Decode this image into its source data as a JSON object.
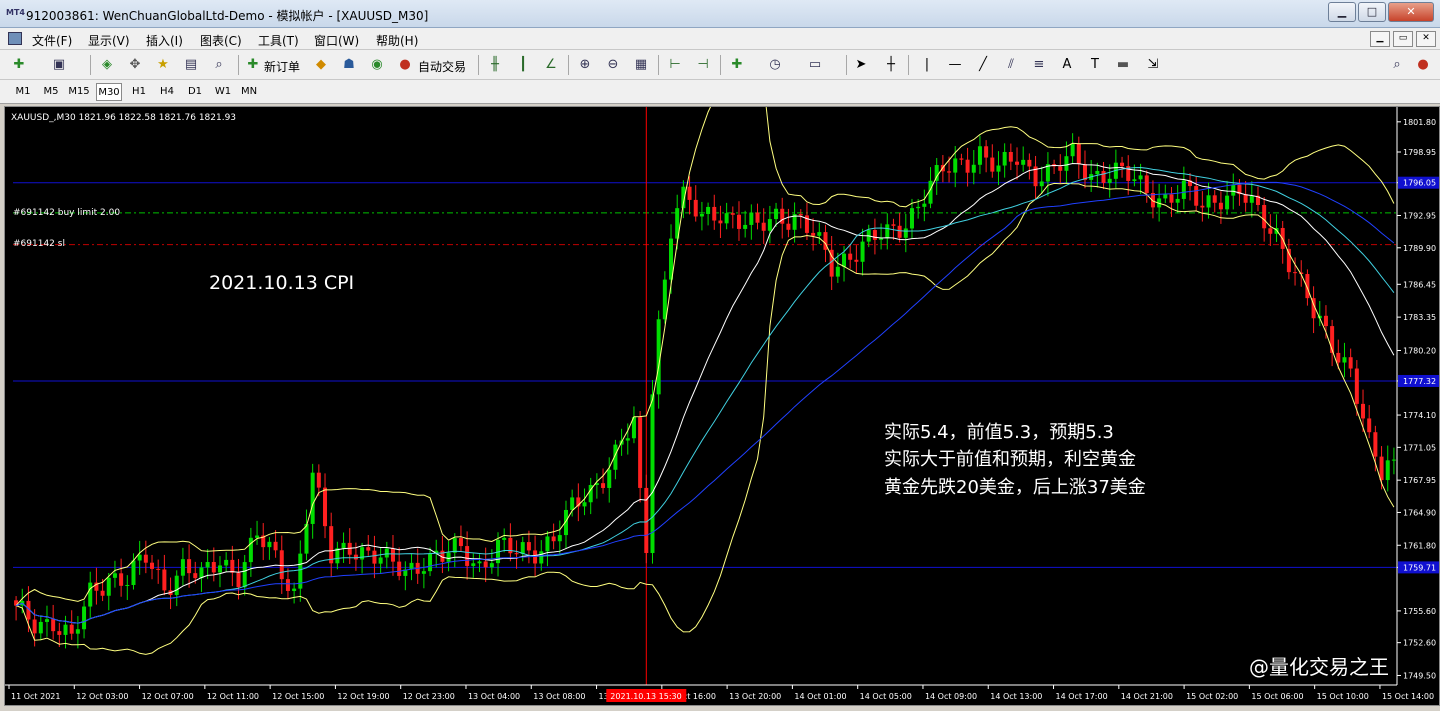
{
  "window": {
    "app_icon": "MT4",
    "title": "912003861: WenChuanGlobalLtd-Demo - 模拟帐户 - [XAUUSD_M30]",
    "minimize": "▁",
    "maximize": "□",
    "close": "✕"
  },
  "menu": {
    "items": [
      "文件(F)",
      "显示(V)",
      "插入(I)",
      "图表(C)",
      "工具(T)",
      "窗口(W)",
      "帮助(H)"
    ],
    "mdi_controls": [
      "▁",
      "▭",
      "✕"
    ]
  },
  "toolbar": {
    "new_order_label": "新订单",
    "auto_trading_label": "自动交易",
    "line_label": "|",
    "hline_label": "—",
    "text_label": "A",
    "textlabel_label": "T"
  },
  "timeframes": [
    "M1",
    "M5",
    "M15",
    "M30",
    "H1",
    "H4",
    "D1",
    "W1",
    "MN"
  ],
  "active_timeframe": "M30",
  "chart": {
    "header": "XAUUSD_,M30  1821.96 1822.58 1821.76 1821.93",
    "order_label_buy": "#691142 buy limit 2.00",
    "order_label_sl": "#691142 sl",
    "event_label": "2021.10.13  CPI",
    "annotation_lines": [
      "实际5.4，前值5.3，预期5.3",
      "实际大于前值和预期，利空黄金",
      "黄金先跌20美金，后上涨37美金"
    ],
    "watermark": "@量化交易之王",
    "crosshair_time_label": "2021.10.13 15:30",
    "hline_price_labels": [
      "1796.05",
      "1777.32",
      "1759.71"
    ],
    "colors": {
      "background": "#000000",
      "bull": "#00dd00",
      "bear": "#ff2020",
      "bollinger": "#ffff80",
      "ma_fast": "#ffffff",
      "ma_mid": "#40d0e0",
      "ma_slow": "#2040ff",
      "hline": "#1010d0",
      "buy_limit": "#00c000",
      "stop_loss": "#c00000",
      "crosshair": "#ff0000"
    }
  },
  "chart_data": {
    "type": "candlestick",
    "symbol": "XAUUSD_",
    "timeframe": "M30",
    "price_axis": [
      1801.8,
      1798.95,
      1796.05,
      1792.95,
      1789.9,
      1786.45,
      1783.35,
      1780.2,
      1777.32,
      1774.1,
      1771.05,
      1767.95,
      1764.9,
      1761.8,
      1759.71,
      1755.6,
      1752.6,
      1749.5
    ],
    "ylim": [
      1748.6,
      1803.2
    ],
    "time_axis": [
      "11 Oct 2021",
      "12 Oct 03:00",
      "12 Oct 07:00",
      "12 Oct 11:00",
      "12 Oct 15:00",
      "12 Oct 19:00",
      "12 Oct 23:00",
      "13 Oct 04:00",
      "13 Oct 08:00",
      "13 Oct 12:00",
      "13 Oct 16:00",
      "13 Oct 20:00",
      "14 Oct 01:00",
      "14 Oct 05:00",
      "14 Oct 09:00",
      "14 Oct 13:00",
      "14 Oct 17:00",
      "14 Oct 21:00",
      "15 Oct 02:00",
      "15 Oct 06:00",
      "15 Oct 10:00",
      "15 Oct 14:00"
    ],
    "levels": {
      "blue_lines": [
        1796.05,
        1777.32,
        1759.71
      ],
      "buy_limit": 1793.2,
      "stop_loss": 1790.2
    },
    "close_path": [
      [
        0,
        1755.5
      ],
      [
        3,
        1754.5
      ],
      [
        6,
        1754.8
      ],
      [
        9,
        1752.6
      ],
      [
        12,
        1757.2
      ],
      [
        15,
        1759.0
      ],
      [
        18,
        1758.5
      ],
      [
        21,
        1760.5
      ],
      [
        24,
        1758.0
      ],
      [
        27,
        1759.8
      ],
      [
        30,
        1758.5
      ],
      [
        33,
        1760.5
      ],
      [
        36,
        1759.2
      ],
      [
        39,
        1762.5
      ],
      [
        42,
        1760.5
      ],
      [
        45,
        1757.5
      ],
      [
        48,
        1768.5
      ],
      [
        51,
        1760.5
      ],
      [
        54,
        1762.0
      ],
      [
        57,
        1761.0
      ],
      [
        60,
        1760.0
      ],
      [
        63,
        1759.5
      ],
      [
        66,
        1760.5
      ],
      [
        69,
        1760.5
      ],
      [
        72,
        1761.5
      ],
      [
        75,
        1760.0
      ],
      [
        78,
        1761.5
      ],
      [
        81,
        1761.0
      ],
      [
        84,
        1761.5
      ],
      [
        87,
        1762.5
      ],
      [
        90,
        1765.0
      ],
      [
        93,
        1767.0
      ],
      [
        96,
        1769.5
      ],
      [
        98,
        1771.5
      ],
      [
        100,
        1773.0
      ],
      [
        101,
        1766.0
      ],
      [
        102,
        1761.5
      ],
      [
        103,
        1777.0
      ],
      [
        104,
        1783.0
      ],
      [
        105,
        1787.0
      ],
      [
        106,
        1792.0
      ],
      [
        107,
        1794.0
      ],
      [
        108,
        1794.5
      ],
      [
        111,
        1792.5
      ],
      [
        114,
        1793.5
      ],
      [
        117,
        1792.5
      ],
      [
        120,
        1791.5
      ],
      [
        123,
        1793.0
      ],
      [
        126,
        1793.0
      ],
      [
        129,
        1791.0
      ],
      [
        132,
        1788.0
      ],
      [
        135,
        1789.5
      ],
      [
        138,
        1790.5
      ],
      [
        141,
        1791.0
      ],
      [
        144,
        1792.5
      ],
      [
        147,
        1795.0
      ],
      [
        150,
        1797.0
      ],
      [
        153,
        1798.0
      ],
      [
        156,
        1799.0
      ],
      [
        159,
        1797.0
      ],
      [
        162,
        1798.5
      ],
      [
        165,
        1797.0
      ],
      [
        168,
        1797.0
      ],
      [
        171,
        1798.5
      ],
      [
        174,
        1797.0
      ],
      [
        177,
        1797.0
      ],
      [
        180,
        1796.5
      ],
      [
        183,
        1795.5
      ],
      [
        186,
        1794.5
      ],
      [
        189,
        1795.0
      ],
      [
        192,
        1794.0
      ],
      [
        195,
        1795.0
      ],
      [
        198,
        1795.0
      ],
      [
        201,
        1793.0
      ],
      [
        204,
        1791.5
      ],
      [
        207,
        1787.5
      ],
      [
        210,
        1783.5
      ],
      [
        213,
        1781.0
      ],
      [
        216,
        1778.5
      ],
      [
        219,
        1771.0
      ],
      [
        221,
        1768.5
      ],
      [
        222,
        1769.5
      ]
    ]
  }
}
